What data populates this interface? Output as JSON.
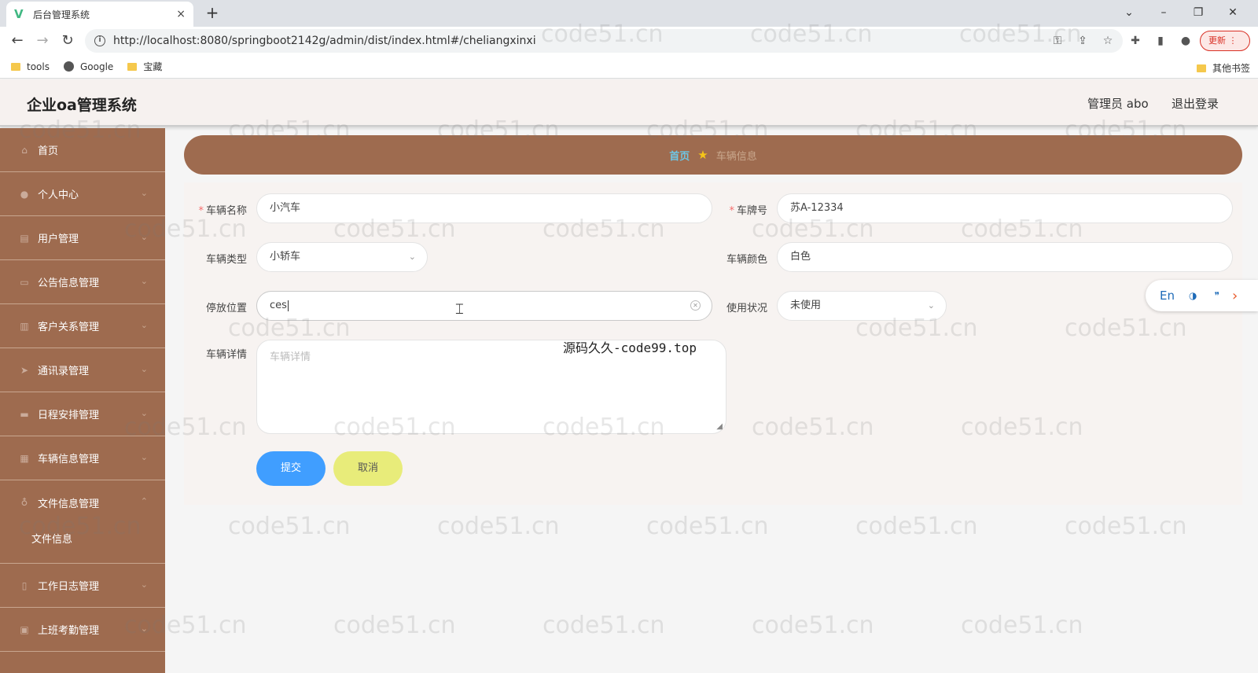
{
  "browser": {
    "tab_title": "后台管理系统",
    "tab_close": "×",
    "new_tab": "+",
    "url": "http://localhost:8080/springboot2142g/admin/dist/index.html#/cheliangxinxi",
    "update_label": "更新",
    "bookmarks": [
      "tools",
      "Google",
      "宝藏"
    ],
    "other_bookmarks": "其他书签"
  },
  "header": {
    "app_title": "企业oa管理系统",
    "user": "管理员 abo",
    "logout": "退出登录"
  },
  "sidebar": {
    "items": [
      {
        "label": "首页",
        "icon": "home-icon"
      },
      {
        "label": "个人中心",
        "icon": "user-icon"
      },
      {
        "label": "用户管理",
        "icon": "users-icon"
      },
      {
        "label": "公告信息管理",
        "icon": "notice-icon"
      },
      {
        "label": "客户关系管理",
        "icon": "chart-icon"
      },
      {
        "label": "通讯录管理",
        "icon": "send-icon"
      },
      {
        "label": "日程安排管理",
        "icon": "chat-icon"
      },
      {
        "label": "车辆信息管理",
        "icon": "grid-icon"
      },
      {
        "label": "文件信息管理",
        "icon": "mic-icon"
      },
      {
        "label": "工作日志管理",
        "icon": "clipboard-icon"
      },
      {
        "label": "上班考勤管理",
        "icon": "calendar-icon"
      }
    ],
    "sub_item": "文件信息"
  },
  "breadcrumb": {
    "home": "首页",
    "current": "车辆信息"
  },
  "form": {
    "name_label": "车辆名称",
    "name_value": "小汽车",
    "plate_label": "车牌号",
    "plate_value": "苏A-12334",
    "type_label": "车辆类型",
    "type_value": "小轿车",
    "color_label": "车辆颜色",
    "color_value": "白色",
    "location_label": "停放位置",
    "location_value": "ces",
    "status_label": "使用状况",
    "status_value": "未使用",
    "detail_label": "车辆详情",
    "detail_placeholder": "车辆详情",
    "submit": "提交",
    "cancel": "取消"
  },
  "overlay_text": "源码久久-code99.top",
  "float_tool": {
    "lang": "En"
  },
  "watermark": "code51.cn",
  "colors": {
    "sidebar": "#9e6b4f",
    "breadcrumb_bg": "#9e6b4f",
    "submit": "#409eff",
    "cancel": "#e8ec7a"
  }
}
